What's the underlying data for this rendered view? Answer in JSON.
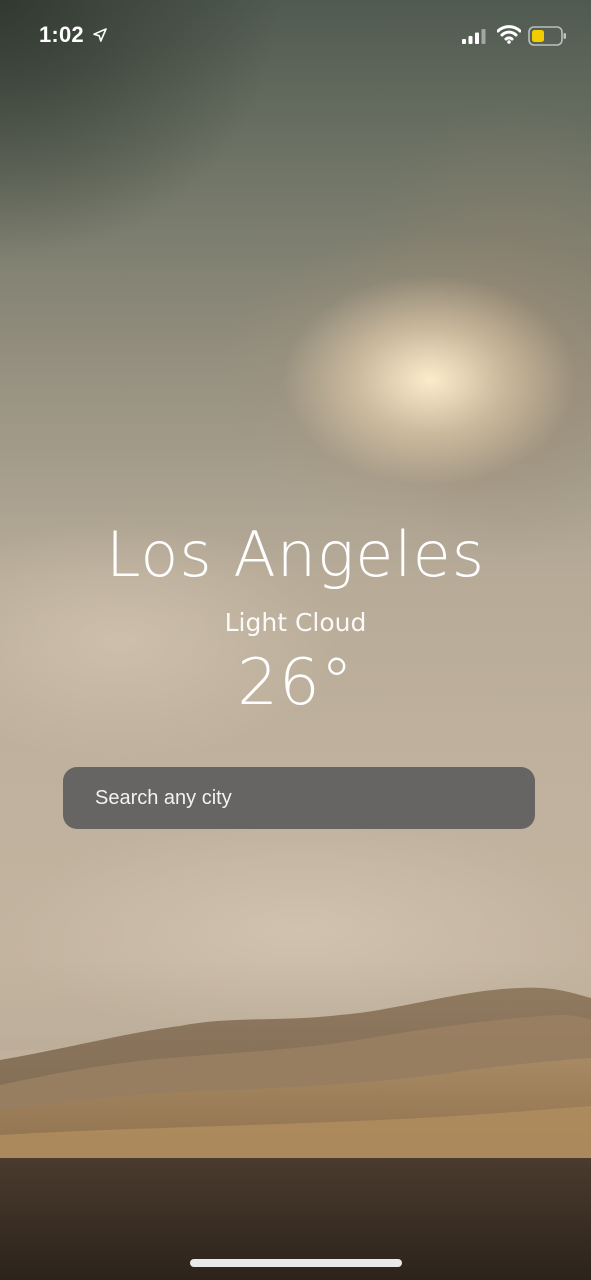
{
  "status_bar": {
    "time": "1:02",
    "battery_color": "#f3cc00"
  },
  "weather": {
    "city": "Los Angeles",
    "condition": "Light Cloud",
    "temperature": "26°"
  },
  "search": {
    "placeholder": "Search any city"
  },
  "icons": [
    "location-arrow-icon",
    "cellular-signal-icon",
    "wifi-icon",
    "battery-icon"
  ]
}
